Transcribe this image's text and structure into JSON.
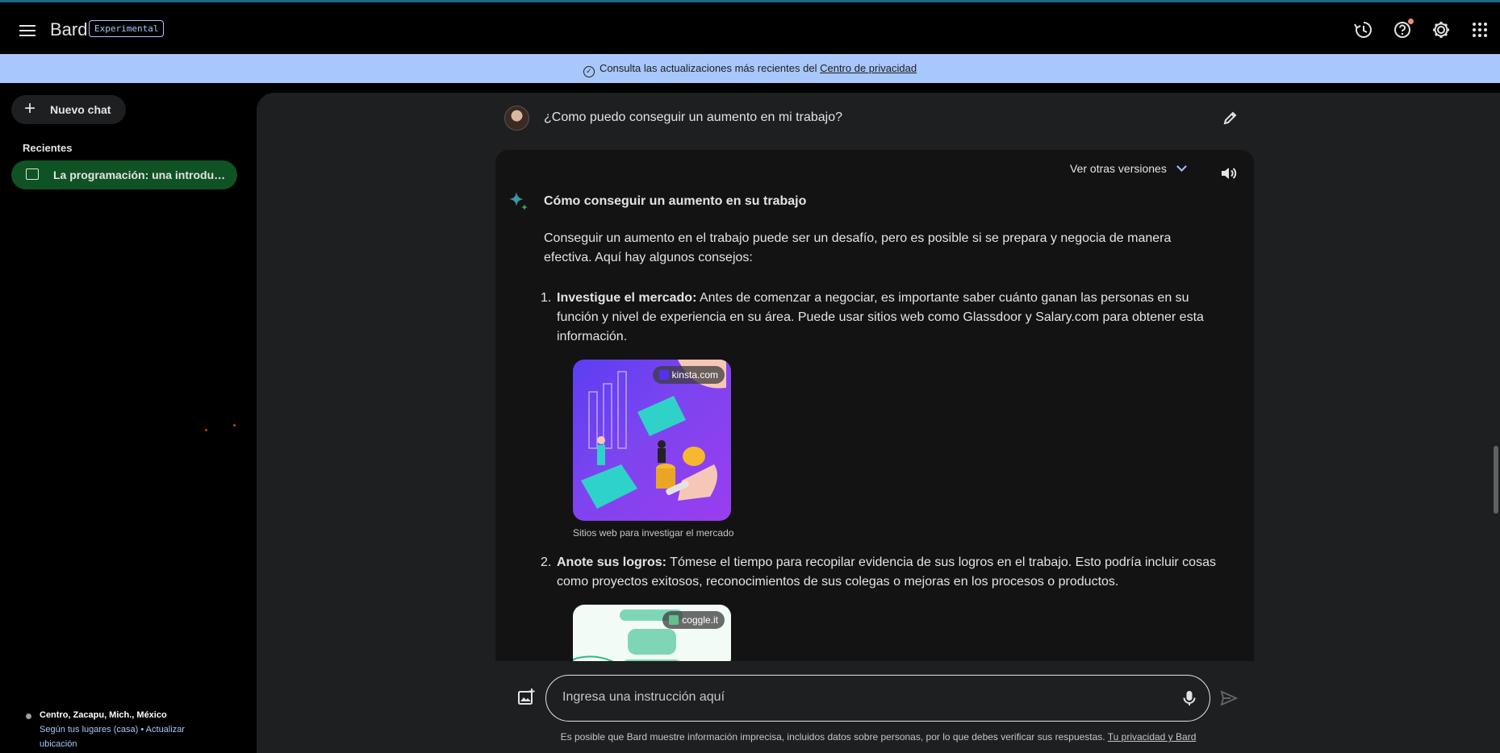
{
  "app": {
    "logo": "Bard",
    "badge": "Experimental"
  },
  "colors": {
    "banner_bg": "#a8c7fa",
    "active_chat_bg": "#0f5223",
    "panel_bg": "#1e1f20",
    "response_bg": "#131314"
  },
  "header_icons": [
    "history-icon",
    "help-icon",
    "settings-icon",
    "apps-grid-icon"
  ],
  "banner": {
    "text": "Consulta las actualizaciones más recientes del",
    "link": "Centro de privacidad"
  },
  "sidebar": {
    "new_chat": "Nuevo chat",
    "recent_heading": "Recientes",
    "recent_items": [
      {
        "label": "La programación: una introducción"
      }
    ],
    "location": {
      "place": "Centro, Zacapu, Mich., México",
      "source": "Según tus lugares (casa)",
      "separator": "•",
      "update": "Actualizar ubicación"
    }
  },
  "conversation": {
    "user_prompt": "¿Como puedo conseguir un aumento en mi trabajo?",
    "response": {
      "other_versions": "Ver otras versiones",
      "title": "Cómo conseguir un aumento en su trabajo",
      "intro": "Conseguir un aumento en el trabajo puede ser un desafío, pero es posible si se prepara y negocia de manera efectiva. Aquí hay algunos consejos:",
      "items": [
        {
          "num": "1.",
          "bold": "Investigue el mercado:",
          "text": " Antes de comenzar a negociar, es importante saber cuánto ganan las personas en su función y nivel de experiencia en su área. Puede usar sitios web como Glassdoor y Salary.com para obtener esta información.",
          "image_source": "kinsta.com",
          "image_caption": "Sitios web para investigar el mercado"
        },
        {
          "num": "2.",
          "bold": "Anote sus logros:",
          "text": " Tómese el tiempo para recopilar evidencia de sus logros en el trabajo. Esto podría incluir cosas como proyectos exitosos, reconocimientos de sus colegas o mejoras en los procesos o productos.",
          "image_source": "coggle.it"
        }
      ]
    }
  },
  "input": {
    "placeholder": "Ingresa una instrucción aquí"
  },
  "disclaimer": {
    "text": "Es posible que Bard muestre información imprecisa, incluidos datos sobre personas, por lo que debes verificar sus respuestas.",
    "link": "Tu privacidad y Bard"
  }
}
